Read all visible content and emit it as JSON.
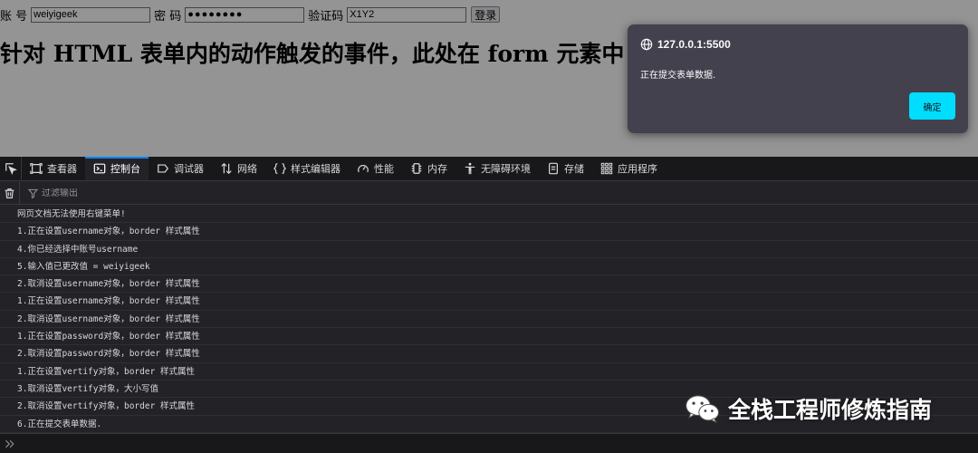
{
  "page": {
    "account_label": "账 号",
    "username_value": "weiyigeek",
    "password_label": "密 码",
    "password_value": "●●●●●●●●",
    "verify_label": "验证码",
    "verify_value": "X1Y2",
    "login_label": "登录",
    "heading": "针对 HTML 表单内的动作触发的事件，此处在 form 元素中"
  },
  "alert": {
    "origin": "127.0.0.1:5500",
    "message": "正在提交表单数据.",
    "ok_label": "确定"
  },
  "devtools": {
    "tabs": [
      {
        "label": "查看器",
        "icon": "inspector-icon"
      },
      {
        "label": "控制台",
        "icon": "console-icon",
        "active": true
      },
      {
        "label": "调试器",
        "icon": "debugger-icon"
      },
      {
        "label": "网络",
        "icon": "network-icon"
      },
      {
        "label": "样式编辑器",
        "icon": "style-editor-icon"
      },
      {
        "label": "性能",
        "icon": "performance-icon"
      },
      {
        "label": "内存",
        "icon": "memory-icon"
      },
      {
        "label": "无障碍环境",
        "icon": "accessibility-icon"
      },
      {
        "label": "存储",
        "icon": "storage-icon"
      },
      {
        "label": "应用程序",
        "icon": "application-icon"
      }
    ],
    "filter_placeholder": "过滤输出",
    "console_lines": [
      "网页文档无法使用右键菜单!",
      "1.正在设置username对象，border 样式属性",
      "4.你已经选择中账号username",
      "5.输入值已更改值 = weiyigeek",
      "2.取消设置username对象，border 样式属性",
      "1.正在设置username对象，border 样式属性",
      "2.取消设置username对象，border 样式属性",
      "1.正在设置password对象，border 样式属性",
      "2.取消设置password对象，border 样式属性",
      "1.正在设置vertify对象，border 样式属性",
      "3.取消设置vertify对象，大小写值",
      "2.取消设置vertify对象，border 样式属性",
      "6.正在提交表单数据."
    ]
  },
  "watermark": {
    "text": "全栈工程师修炼指南",
    "icon": "wechat-icon"
  },
  "colors": {
    "accent_button": "#00ddff",
    "active_tab_line": "#0a84ff",
    "dialog_bg": "#42414d",
    "toolbar_bg": "#18181a",
    "console_bg": "#232327"
  }
}
